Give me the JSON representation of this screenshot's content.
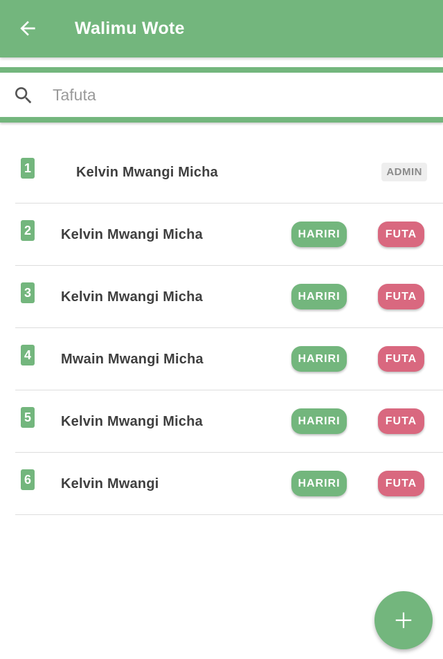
{
  "appbar": {
    "title": "Walimu Wote",
    "back_icon": "arrow-left-icon",
    "background_color": "#73b67d"
  },
  "search": {
    "placeholder": "Tafuta",
    "value": "",
    "icon": "search-icon"
  },
  "teachers": [
    {
      "number": "1",
      "name": "Kelvin Mwangi Micha",
      "admin_label": "ADMIN"
    },
    {
      "number": "2",
      "name": "Kelvin Mwangi Micha",
      "edit_label": "HARIRI",
      "delete_label": "FUTA"
    },
    {
      "number": "3",
      "name": "Kelvin Mwangi Micha",
      "edit_label": "HARIRI",
      "delete_label": "FUTA"
    },
    {
      "number": "4",
      "name": "Mwain Mwangi Micha",
      "edit_label": "HARIRI",
      "delete_label": "FUTA"
    },
    {
      "number": "5",
      "name": "Kelvin Mwangi Micha",
      "edit_label": "HARIRI",
      "delete_label": "FUTA"
    },
    {
      "number": "6",
      "name": "Kelvin Mwangi",
      "edit_label": "HARIRI",
      "delete_label": "FUTA"
    }
  ],
  "colors": {
    "primary": "#73b67d",
    "danger": "#d9687f",
    "admin_tag_bg": "#eeeeee"
  },
  "fab": {
    "icon": "plus-icon"
  }
}
